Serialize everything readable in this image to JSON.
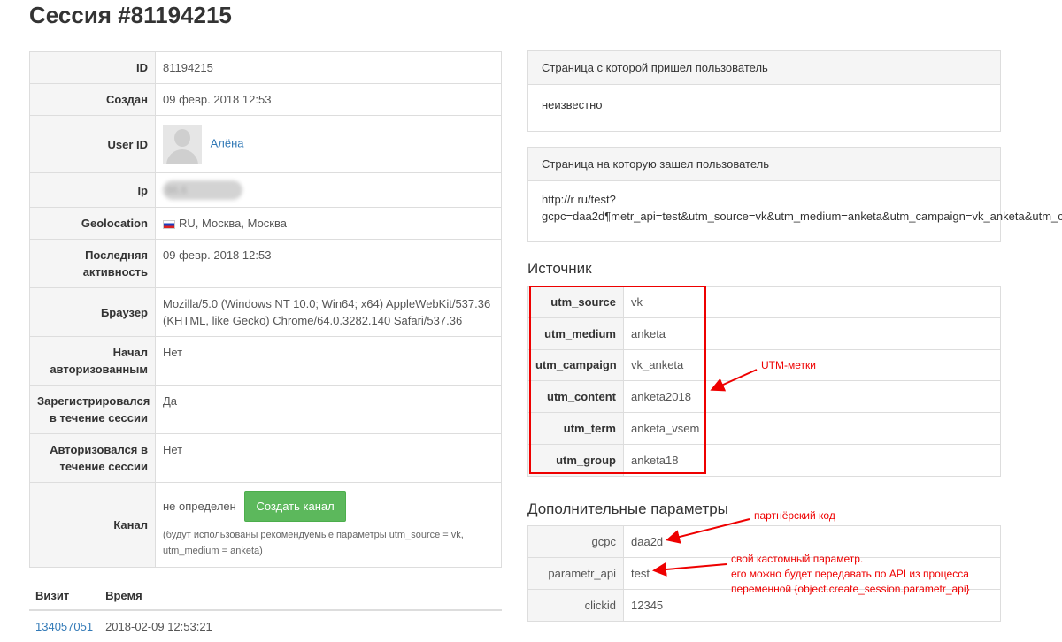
{
  "title": "Сессия #81194215",
  "info": [
    {
      "label": "ID",
      "value": "81194215"
    },
    {
      "label": "Создан",
      "value": "09 февр. 2018 12:53"
    },
    {
      "label": "User ID",
      "value": "Алёна"
    },
    {
      "label": "Ip",
      "value": "86.6"
    },
    {
      "label": "Geolocation",
      "value": "RU, Москва, Москва"
    },
    {
      "label": "Последняя активность",
      "value": "09 февр. 2018 12:53"
    },
    {
      "label": "Браузер",
      "value": "Mozilla/5.0 (Windows NT 10.0; Win64; x64) AppleWebKit/537.36 (KHTML, like Gecko) Chrome/64.0.3282.140 Safari/537.36"
    },
    {
      "label": "Начал авторизованным",
      "value": "Нет"
    },
    {
      "label": "Зарегистрировался в течение сессии",
      "value": "Да"
    },
    {
      "label": "Авторизовался в течение сессии",
      "value": "Нет"
    },
    {
      "label": "Канал",
      "value": "не определен",
      "button": "Создать канал",
      "hint": "(будут использованы рекомендуемые параметры utm_source = vk, utm_medium = anketa)"
    }
  ],
  "visits": {
    "headers": [
      "Визит",
      "Время"
    ],
    "rows": [
      {
        "id": "134057051",
        "time": "2018-02-09 12:53:21"
      }
    ]
  },
  "referrer": {
    "heading": "Страница с которой пришел пользователь",
    "value": "неизвестно"
  },
  "landing": {
    "heading": "Страница на которую зашел пользователь",
    "line1": "http://r        ru/test?",
    "line2": "gcpc=daa2d¶metr_api=test&utm_source=vk&utm_medium=anketa&utm_campaign=vk_anketa&utm_c"
  },
  "source": {
    "title": "Источник",
    "rows": [
      {
        "key": "utm_source",
        "value": "vk"
      },
      {
        "key": "utm_medium",
        "value": "anketa"
      },
      {
        "key": "utm_campaign",
        "value": "vk_anketa"
      },
      {
        "key": "utm_content",
        "value": "anketa2018"
      },
      {
        "key": "utm_term",
        "value": "anketa_vsem"
      },
      {
        "key": "utm_group",
        "value": "anketa18"
      }
    ]
  },
  "extra": {
    "title": "Дополнительные параметры",
    "rows": [
      {
        "key": "gcpc",
        "value": "daa2d"
      },
      {
        "key": "parametr_api",
        "value": "test"
      },
      {
        "key": "clickid",
        "value": "12345"
      }
    ]
  },
  "annotations": {
    "utm": "UTM-метки",
    "partner": "партнёрский код",
    "custom_1": "свой кастомный параметр.",
    "custom_2": "его можно будет передавать по API из процесса",
    "custom_3": "переменной {object.create_session.parametr_api}"
  },
  "colors": {
    "annotation": "#e00000",
    "button": "#5cb85c",
    "link": "#337ab7"
  }
}
